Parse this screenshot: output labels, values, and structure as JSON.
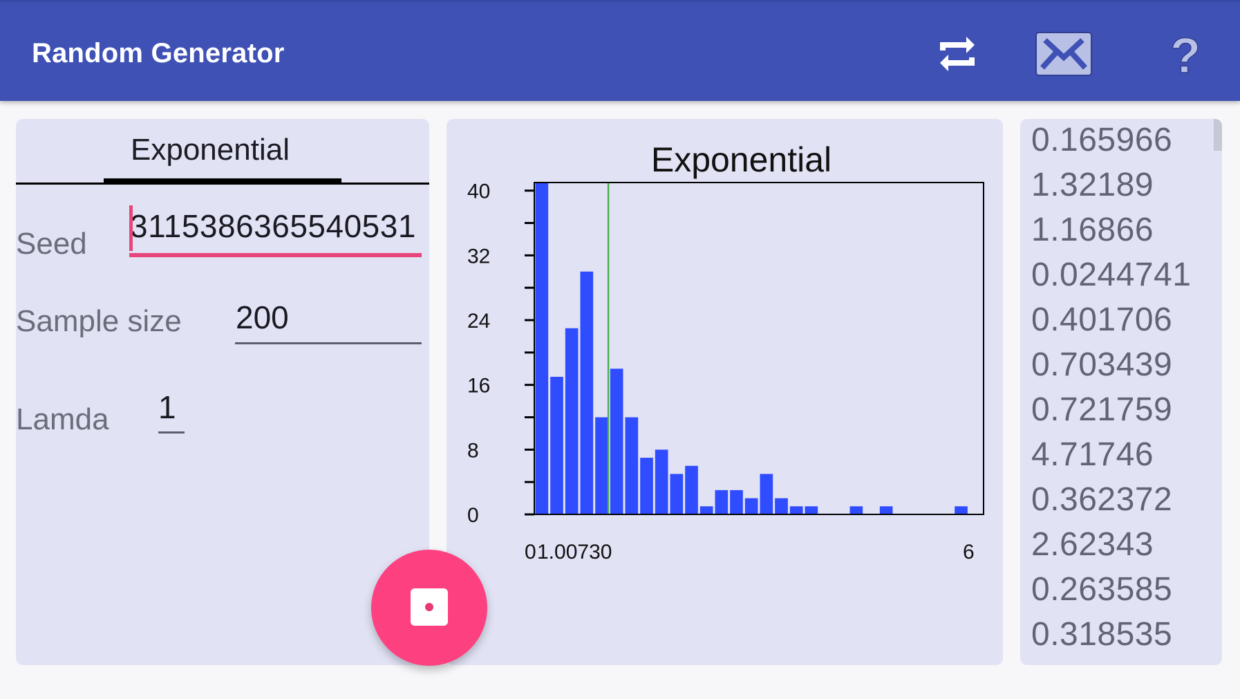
{
  "appbar": {
    "title": "Random Generator",
    "icons": [
      "repeat-icon",
      "mail-icon",
      "help-icon"
    ],
    "color": "#3f51b5"
  },
  "left_panel": {
    "tab_label": "Exponential",
    "fields": {
      "seed": {
        "label": "Seed",
        "value": "3115386365540531"
      },
      "sample_size": {
        "label": "Sample size",
        "value": "200"
      },
      "lamda": {
        "label": "Lamda",
        "value": "1"
      }
    },
    "accent_color": "#e8457a"
  },
  "fab": {
    "icon": "dice-icon",
    "color": "#fd4080"
  },
  "chart_data": {
    "type": "bar",
    "title": "Exponential",
    "xlabel": "",
    "ylabel": "",
    "bins": 30,
    "xlim": [
      0,
      6
    ],
    "ylim": [
      0,
      41
    ],
    "yticks": [
      0,
      8,
      16,
      24,
      32,
      40
    ],
    "ytick_labels": [
      "0",
      "8",
      "16",
      "24",
      "32",
      "40"
    ],
    "xtick_labels": [
      {
        "value": 0,
        "label": "0"
      },
      {
        "value": 1.0073,
        "label": "1.00730"
      },
      {
        "value": 6,
        "label": "6"
      }
    ],
    "mean_line": {
      "value": 1.0073,
      "color": "#4caf50"
    },
    "bar_color": "#2f4cff",
    "values": [
      41,
      17,
      23,
      30,
      12,
      18,
      12,
      7,
      8,
      5,
      6,
      1,
      3,
      3,
      2,
      5,
      2,
      1,
      1,
      0,
      0,
      1,
      0,
      1,
      0,
      0,
      0,
      0,
      1,
      0
    ],
    "grid": false
  },
  "values_list": [
    "0.165966",
    "1.32189",
    "1.16866",
    "0.0244741",
    "0.401706",
    "0.703439",
    "0.721759",
    "4.71746",
    "0.362372",
    "2.62343",
    "0.263585",
    "0.318535"
  ]
}
